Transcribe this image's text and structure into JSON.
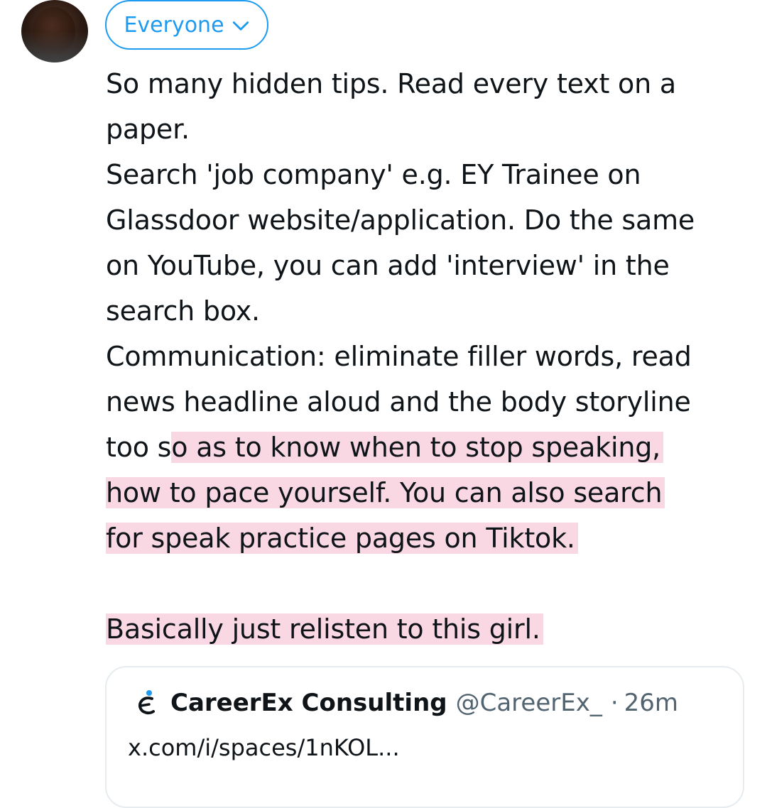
{
  "audience": {
    "label": "Everyone",
    "icon": "chevron-down-icon",
    "accent_color": "#1d9bf0"
  },
  "tweet": {
    "lines": [
      "So many hidden tips. Read every text on a",
      "paper.",
      "Search 'job company' e.g. EY Trainee on",
      "Glassdoor website/application. Do the same",
      "on YouTube, you can add 'interview' in the",
      "search box.",
      "Communication: eliminate filler words, read",
      "news headline aloud and the body storyline",
      "too s",
      "o as to know when to stop speaking,",
      "how to pace yourself. You can also search",
      "for speak practice pages on Tiktok.",
      "Basically just relisten to this girl."
    ],
    "highlight_color": "#f9d7e3"
  },
  "quote": {
    "name": "CareerEx Consulting",
    "handle": "@CareerEx_",
    "separator": "·",
    "time": "26m",
    "link_text": "x.com/i/spaces/1nKOL..."
  }
}
